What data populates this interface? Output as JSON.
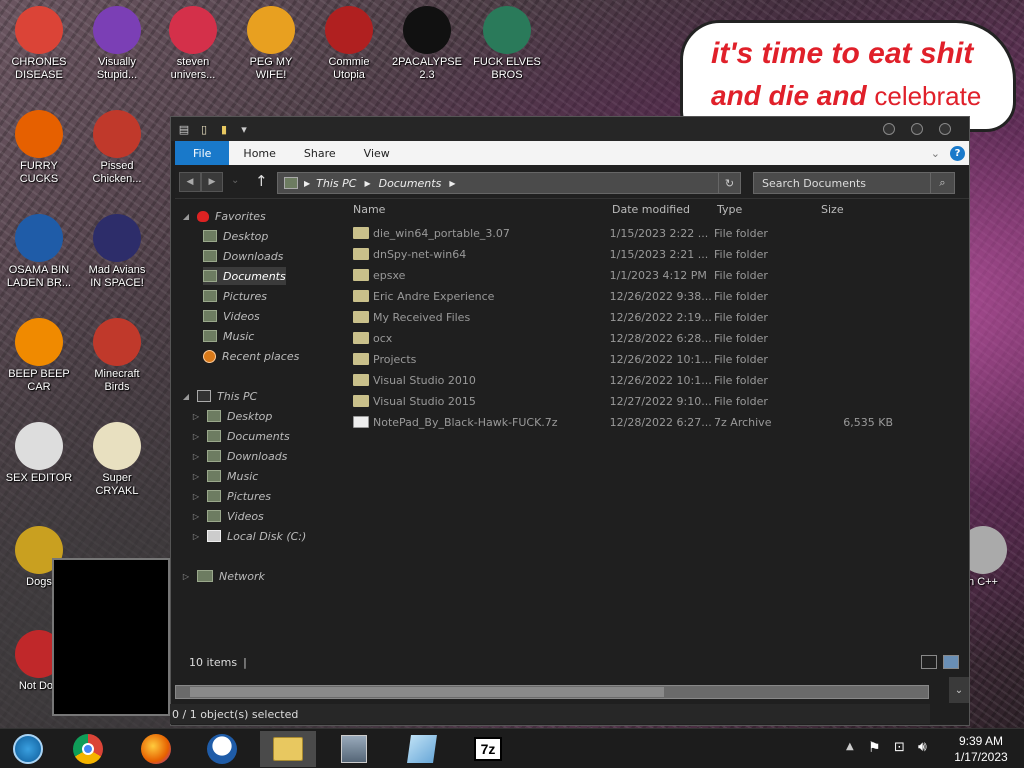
{
  "desktop": {
    "icons": [
      {
        "label": "CHRONES\nDISEASE",
        "icon": "chrome-icon",
        "color": "#db4437"
      },
      {
        "label": "Visually\nStupid...",
        "icon": "visual-studio-icon",
        "color": "#7b3fb5"
      },
      {
        "label": "steven\nunivers...",
        "icon": "steven-universe-icon",
        "color": "#d4304a"
      },
      {
        "label": "PEG MY WIFE!",
        "icon": "pegasus-icon",
        "color": "#e8a020"
      },
      {
        "label": "Commie\nUtopia",
        "icon": "commie-utopia-icon",
        "color": "#b02020"
      },
      {
        "label": "2PACALYPSE\n2.3",
        "icon": "cmd-icon",
        "color": "#111111"
      },
      {
        "label": "FUCK ELVES\nBROS",
        "icon": "elves-bros-icon",
        "color": "#2a7a5a"
      },
      {
        "label": "FURRY CUCKS",
        "icon": "firefox-icon",
        "color": "#e66000"
      },
      {
        "label": "Pissed\nChicken...",
        "icon": "angry-birds-seasons-icon",
        "color": "#c0392b"
      },
      {
        "label": "OSAMA BIN\nLADEN BR...",
        "icon": "obama-logo-icon",
        "color": "#1f5ca8"
      },
      {
        "label": "Mad Avians\nIN SPACE!",
        "icon": "angry-birds-space-icon",
        "color": "#2d2d6a"
      },
      {
        "label": "BEEP BEEP\nCAR",
        "icon": "vlc-icon",
        "color": "#f08a00"
      },
      {
        "label": "Minecraft\nBirds",
        "icon": "angry-birds-icon",
        "color": "#c0392b"
      },
      {
        "label": "SEX EDITOR",
        "icon": "hxd-icon",
        "color": "#dddddd"
      },
      {
        "label": "Super CRYAKL",
        "icon": "pixel-dog-icon",
        "color": "#e8e0c0"
      },
      {
        "label": "Dogs",
        "icon": "dogs-icon",
        "color": "#c9a020"
      },
      {
        "label": "Not Dog",
        "icon": "dev-cpp-icon",
        "color": "#c0282a"
      },
      {
        "label": "n C++",
        "icon": "recycle-bin-icon",
        "color": "#aaaaaa"
      }
    ],
    "bubble_line1": "it's time to eat shit",
    "bubble_line2a": "and die and",
    "bubble_line2b": "celebrate"
  },
  "explorer": {
    "ribbon_tabs": [
      "File",
      "Home",
      "Share",
      "View"
    ],
    "path": [
      "This PC",
      "Documents"
    ],
    "search_placeholder": "Search Documents",
    "nav": {
      "favorites_label": "Favorites",
      "favorites": [
        "Desktop",
        "Downloads",
        "Documents",
        "Pictures",
        "Videos",
        "Music",
        "Recent places"
      ],
      "this_pc_label": "This PC",
      "this_pc": [
        "Desktop",
        "Documents",
        "Downloads",
        "Music",
        "Pictures",
        "Videos",
        "Local Disk (C:)"
      ],
      "network_label": "Network"
    },
    "columns": {
      "name": "Name",
      "date": "Date modified",
      "type": "Type",
      "size": "Size"
    },
    "rows": [
      {
        "name": "die_win64_portable_3.07",
        "date": "1/15/2023 2:22 ...",
        "type": "File folder",
        "size": ""
      },
      {
        "name": "dnSpy-net-win64",
        "date": "1/15/2023 2:21 ...",
        "type": "File folder",
        "size": ""
      },
      {
        "name": "epsxe",
        "date": "1/1/2023 4:12 PM",
        "type": "File folder",
        "size": ""
      },
      {
        "name": "Eric Andre Experience",
        "date": "12/26/2022 9:38...",
        "type": "File folder",
        "size": ""
      },
      {
        "name": "My Received Files",
        "date": "12/26/2022 2:19...",
        "type": "File folder",
        "size": ""
      },
      {
        "name": "ocx",
        "date": "12/28/2022 6:28...",
        "type": "File folder",
        "size": ""
      },
      {
        "name": "Projects",
        "date": "12/26/2022 10:1...",
        "type": "File folder",
        "size": ""
      },
      {
        "name": "Visual Studio 2010",
        "date": "12/26/2022 10:1...",
        "type": "File folder",
        "size": ""
      },
      {
        "name": "Visual Studio 2015",
        "date": "12/27/2022 9:10...",
        "type": "File folder",
        "size": ""
      },
      {
        "name": "NotePad_By_Black-Hawk-FUCK.7z",
        "date": "12/28/2022 6:27...",
        "type": "7z Archive",
        "size": "6,535 KB"
      }
    ],
    "item_count": "10 items",
    "selection_status": "0 / 1 object(s) selected"
  },
  "taskbar": {
    "apps": [
      "start-orb-icon",
      "chrome-icon",
      "firefox-icon",
      "obama-logo-icon",
      "file-explorer-icon",
      "installer-icon",
      "notepad-icon",
      "7zip-icon"
    ],
    "seven_zip_label": "7z",
    "time": "9:39 AM",
    "date": "1/17/2023"
  }
}
